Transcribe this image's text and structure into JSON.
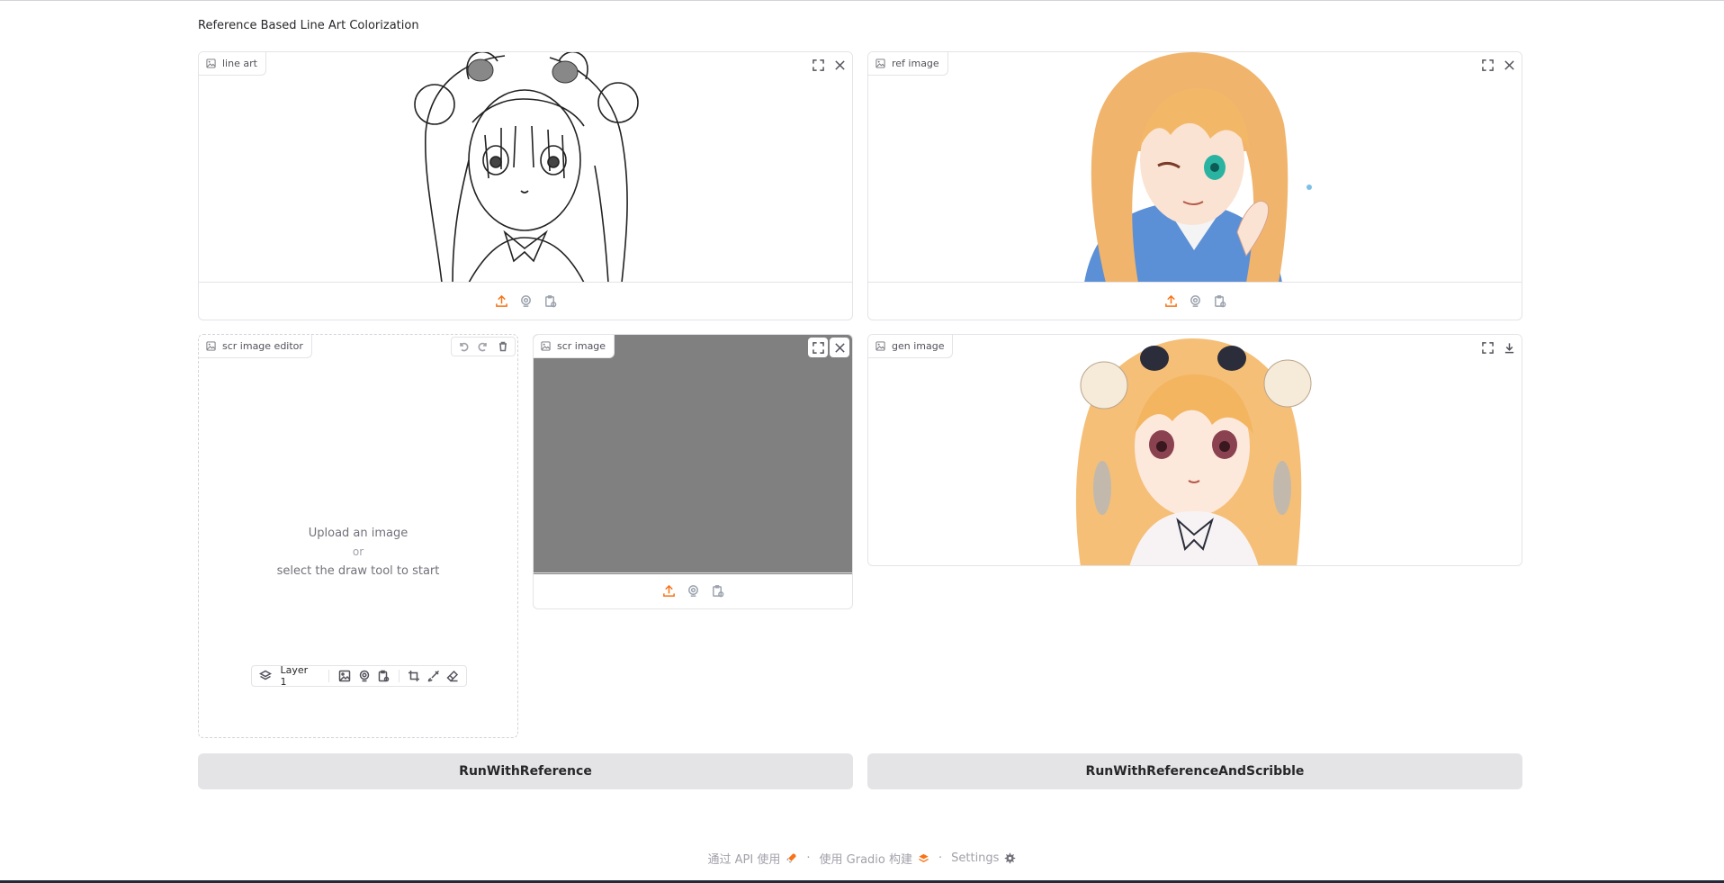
{
  "page": {
    "title": "Reference Based Line Art Colorization"
  },
  "panels": {
    "line_art": {
      "label": "line art"
    },
    "ref_image": {
      "label": "ref image"
    },
    "scr_editor": {
      "label": "scr image editor",
      "upload_text": "Upload an image",
      "or_text": "or",
      "draw_text": "select the draw tool to start",
      "layer_label": "Layer 1"
    },
    "scr_image": {
      "label": "scr image",
      "fill_color": "#808080"
    },
    "gen_image": {
      "label": "gen image"
    }
  },
  "buttons": {
    "run_ref": "RunWithReference",
    "run_ref_scribble": "RunWithReferenceAndScribble"
  },
  "footer": {
    "api": "通过 API 使用",
    "gradio": "使用 Gradio 构建",
    "settings": "Settings"
  },
  "colors": {
    "accent": "#f97316",
    "button_bg": "#e4e4e7",
    "border": "#e4e4e7"
  }
}
